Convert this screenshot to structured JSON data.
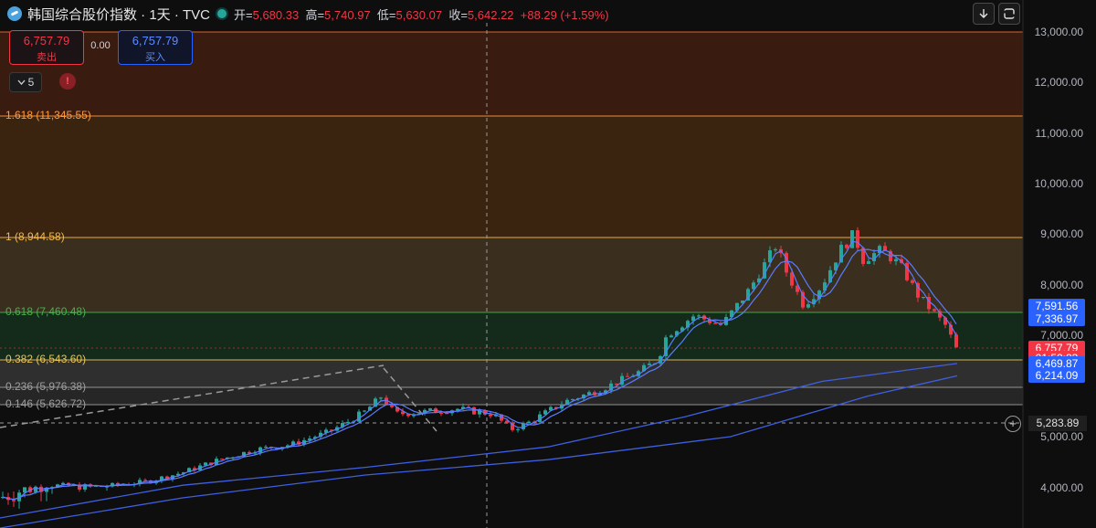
{
  "header": {
    "title": "韩国综合股价指数 · 1天 · TVC",
    "open_label": "开=",
    "open_value": "5,680.33",
    "high_label": "高=",
    "high_value": "5,740.97",
    "low_label": "低=",
    "low_value": "5,630.07",
    "close_label": "收=",
    "close_value": "5,642.22",
    "change": "+88.29 (+1.59%)"
  },
  "toolbar": {
    "download_icon": "download-icon",
    "fullscreen_icon": "fullscreen-icon"
  },
  "trade": {
    "sell_price": "6,757.79",
    "sell_label": "卖出",
    "spread": "0.00",
    "buy_price": "6,757.79",
    "buy_label": "买入"
  },
  "indicators": {
    "count": "5",
    "warning": "!"
  },
  "fib_levels": [
    {
      "label": "1.618 (11,345.55)",
      "value": 11345.55,
      "color": "#ff9a3c"
    },
    {
      "label": "1 (8,944.58)",
      "value": 8944.58,
      "color": "#f5b94a"
    },
    {
      "label": "0.618 (7,460.48)",
      "value": 7460.48,
      "color": "#4caf50"
    },
    {
      "label": "0.382 (6,543.60)",
      "value": 6543.6,
      "color": "#e8c45a"
    },
    {
      "label": "0.236 (5,976.38)",
      "value": 5976.38,
      "color": "#9e9e9e"
    },
    {
      "label": "0.146 (5,626.72)",
      "value": 5626.72,
      "color": "#9e9e9e"
    }
  ],
  "price_axis": [
    "13,000.00",
    "12,000.00",
    "11,000.00",
    "10,000.00",
    "9,000.00",
    "8,000.00",
    "7,000.00",
    "5,000.00",
    "4,000.00"
  ],
  "price_tags": [
    {
      "text": "7,591.56",
      "value": 7591.56,
      "color": "#2962ff"
    },
    {
      "text": "7,336.97",
      "value": 7336.97,
      "color": "#2962ff"
    },
    {
      "text": "6,757.79",
      "value": 6757.79,
      "color": "#f23645"
    },
    {
      "text": "01:52:23",
      "value": 6580,
      "color": "#f23645"
    },
    {
      "text": "6,469.87",
      "value": 6469.87,
      "color": "#2962ff"
    },
    {
      "text": "6,214.09",
      "value": 6214.09,
      "color": "#2962ff"
    }
  ],
  "crosshair": {
    "price": "5,283.89"
  },
  "chart_data": {
    "type": "candlestick",
    "title": "韩国综合股价指数",
    "ylim": [
      3800,
      13300
    ],
    "colors": {
      "up": "#26a69a",
      "down": "#f23645",
      "ma": "#2962ff"
    },
    "last_price": 6757.79
  }
}
